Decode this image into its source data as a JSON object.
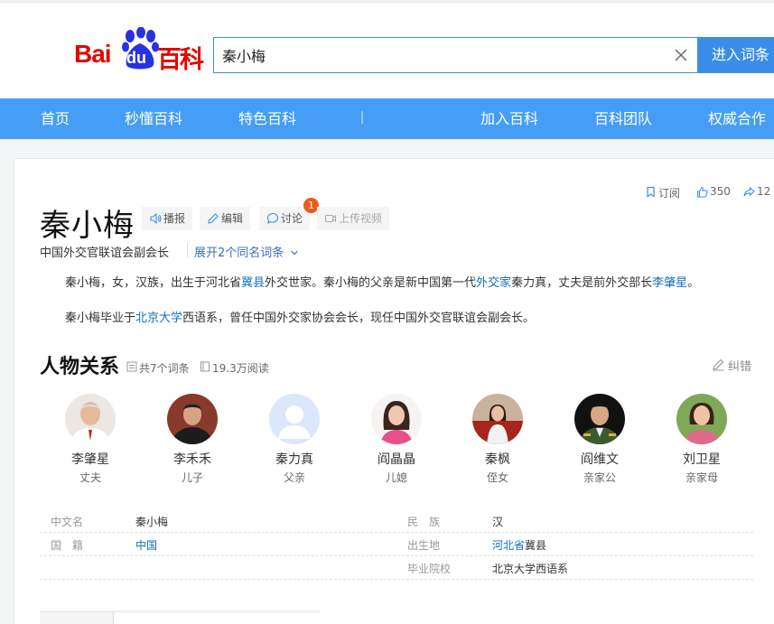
{
  "logo": {
    "bai": "Bai",
    "du": "du",
    "baike": "百科"
  },
  "search": {
    "value": "秦小梅",
    "button": "进入词条"
  },
  "nav": [
    {
      "label": "首页"
    },
    {
      "label": "秒懂百科"
    },
    {
      "label": "特色百科"
    },
    {
      "label": "加入百科"
    },
    {
      "label": "百科团队"
    },
    {
      "label": "权威合作"
    }
  ],
  "entry": {
    "title": "秦小梅",
    "tools": {
      "play": "播报",
      "edit": "编辑",
      "discuss": "讨论",
      "discuss_badge": "1",
      "upload": "上传视频"
    },
    "actions": {
      "subscribe": "订阅",
      "likes": "350",
      "shares": "12"
    },
    "subtitle": "中国外交官联谊会副会长",
    "expand": "展开2个同名词条"
  },
  "summary": {
    "p1": [
      {
        "t": "秦小梅，女，汉族，出生于河北省"
      },
      {
        "t": "冀县",
        "link": true
      },
      {
        "t": "外交世家。秦小梅的父亲是新中国第一代"
      },
      {
        "t": "外交家",
        "link": true
      },
      {
        "t": "秦力真，丈夫是前外交部长"
      },
      {
        "t": "李肇星",
        "link": true
      },
      {
        "t": "。"
      }
    ],
    "p2": [
      {
        "t": "秦小梅毕业于"
      },
      {
        "t": "北京大学",
        "link": true
      },
      {
        "t": "西语系，曾任中国外交家协会会长，现任中国外交官联谊会副会长。"
      }
    ]
  },
  "relations": {
    "title": "人物关系",
    "count": "共7个词条",
    "views": "19.3万阅读",
    "correct": "纠错",
    "people": [
      {
        "name": "李肇星",
        "relation": "丈夫"
      },
      {
        "name": "李禾禾",
        "relation": "儿子"
      },
      {
        "name": "秦力真",
        "relation": "父亲"
      },
      {
        "name": "阎晶晶",
        "relation": "儿媳"
      },
      {
        "name": "秦枫",
        "relation": "侄女"
      },
      {
        "name": "阎维文",
        "relation": "亲家公"
      },
      {
        "name": "刘卫星",
        "relation": "亲家母"
      }
    ]
  },
  "info": {
    "chinese_name": {
      "k": "中文名",
      "v": "秦小梅"
    },
    "nationality": {
      "k": "国　籍",
      "v": "中国"
    },
    "ethnicity": {
      "k": "民　族",
      "v": "汉"
    },
    "birthplace": {
      "k": "出生地",
      "v_link": "河北省",
      "v_rest": "冀县"
    },
    "school": {
      "k": "毕业院校",
      "v": "北京大学西语系"
    }
  }
}
